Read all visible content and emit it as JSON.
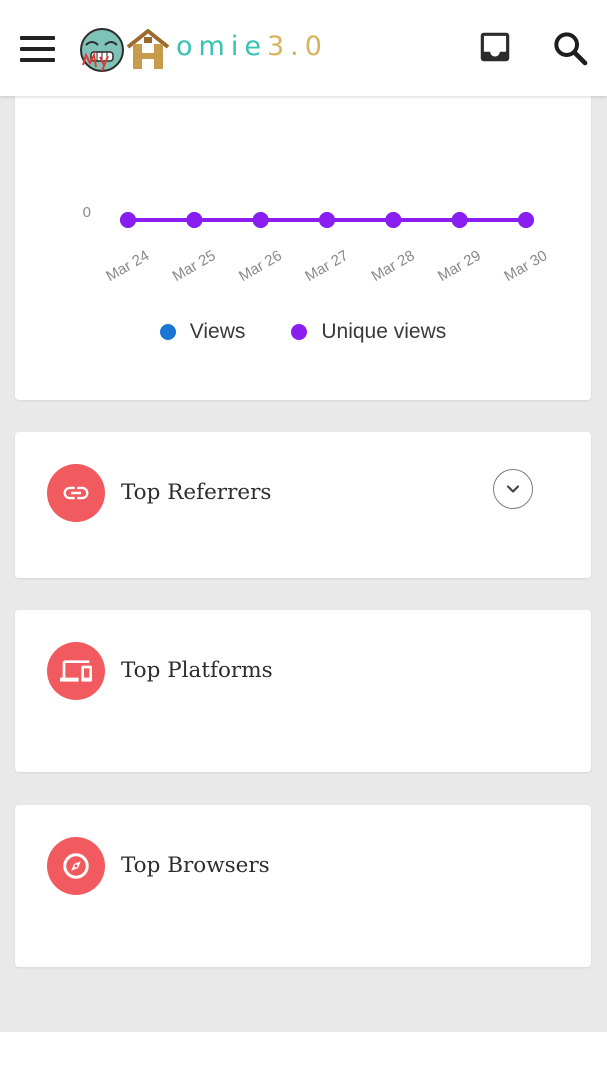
{
  "app": {
    "logo_text_teal": "omie",
    "logo_text_gold": "3.0",
    "logo_lettering": "MyHomie3.0"
  },
  "toolbar": {
    "menu_icon": "hamburger-menu-icon",
    "inbox_icon": "inbox-icon",
    "search_icon": "search-icon"
  },
  "chart_data": {
    "type": "line",
    "x": [
      "Mar 24",
      "Mar 25",
      "Mar 26",
      "Mar 27",
      "Mar 28",
      "Mar 29",
      "Mar 30"
    ],
    "y_ticks": [
      "0"
    ],
    "series": [
      {
        "name": "Views",
        "values": [
          0,
          0,
          0,
          0,
          0,
          0,
          0
        ],
        "color": "#1976d2"
      },
      {
        "name": "Unique views",
        "values": [
          0,
          0,
          0,
          0,
          0,
          0,
          0
        ],
        "color": "#8a1ef0"
      }
    ],
    "legend_position": "bottom"
  },
  "legend": {
    "views": "Views",
    "unique_views": "Unique views"
  },
  "sections": {
    "referrers": {
      "title": "Top Referrers",
      "icon": "link-icon",
      "accent": "#f15a5f"
    },
    "platforms": {
      "title": "Top Platforms",
      "icon": "devices-icon",
      "accent": "#f15a5f"
    },
    "browsers": {
      "title": "Top Browsers",
      "icon": "compass-icon",
      "accent": "#f15a5f"
    }
  }
}
